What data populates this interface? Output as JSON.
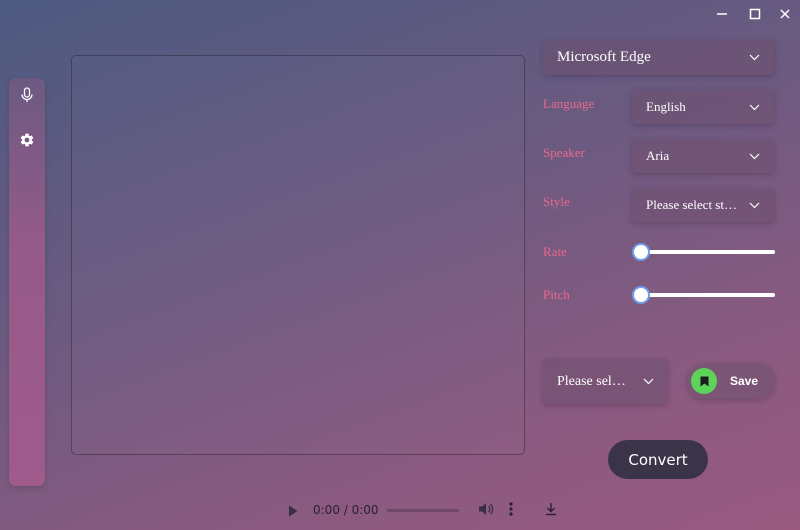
{
  "window": {
    "minimize_icon": "minimize-icon",
    "maximize_icon": "maximize-icon",
    "close_icon": "close-icon"
  },
  "sidebar": {
    "items": [
      {
        "icon": "microphone-icon"
      },
      {
        "icon": "gear-icon"
      }
    ]
  },
  "editor": {
    "value": "",
    "placeholder": ""
  },
  "engine_select": {
    "value": "Microsoft Edge"
  },
  "settings": {
    "language": {
      "label": "Language",
      "value": "English"
    },
    "speaker": {
      "label": "Speaker",
      "value": "Aria"
    },
    "style": {
      "label": "Style",
      "value": "Please select st…"
    },
    "rate": {
      "label": "Rate",
      "level": 0
    },
    "pitch": {
      "label": "Pitch",
      "level": 0
    }
  },
  "format_select": {
    "value": "Please sel…"
  },
  "save_button": {
    "label": "Save"
  },
  "convert_button": {
    "label": "Convert"
  },
  "player": {
    "time": "0:00 / 0:00",
    "progress": 0
  },
  "colors": {
    "label": "#e86a8a",
    "slider_thumb_border": "#6d9ce8",
    "save_icon_bg": "#5ed35a",
    "convert_bg": "#3b3448"
  }
}
